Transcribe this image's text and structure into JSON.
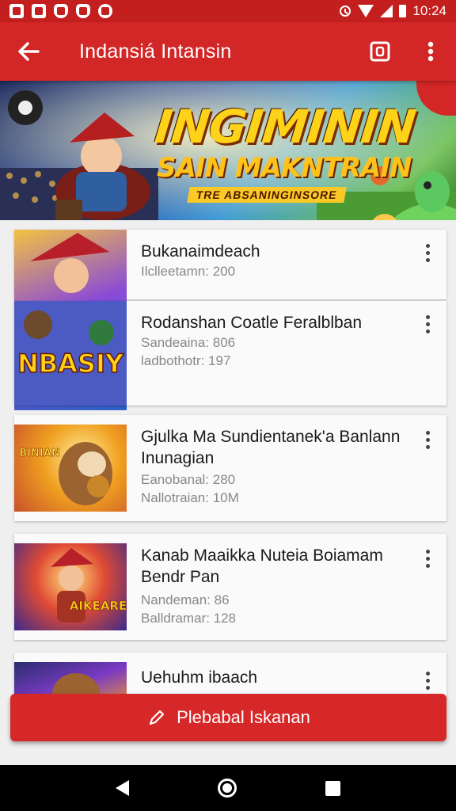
{
  "status_bar": {
    "time": "10:24"
  },
  "app_bar": {
    "title": "Indansiá Intansin"
  },
  "banner": {
    "title": "INGIMININ",
    "subtitle": "SAIN MAKNTRAIN",
    "tagline": "TRE ABSANINGINSORE"
  },
  "items": [
    {
      "title": "Bukanaimdeach",
      "meta": [
        "Ilclleetamn: 200"
      ],
      "thumb_text": ""
    },
    {
      "title": "Rodanshan Coatle Feralblban",
      "meta": [
        "Sandeaina: 806",
        "ladbothotr: 197"
      ],
      "thumb_text": "NBASIY"
    },
    {
      "title": "Gjulka Ma Sundientanek'a Banlann Inunagian",
      "meta": [
        "Eanobanal: 280",
        "Nallotraian: 10M"
      ],
      "thumb_text": "BINIAN"
    },
    {
      "title": "Kanab Maaikka Nuteia Boiamam Bendr Pan",
      "meta": [
        "Nandeman: 86",
        "Balldramar: 128"
      ],
      "thumb_text": "AIKEARE"
    },
    {
      "title": "Uehuhm ibaach",
      "meta": [],
      "thumb_text": ""
    }
  ],
  "fab": {
    "label": "Plebabal Iskanan",
    "icon": "pencil-icon"
  },
  "colors": {
    "primary": "#d32626",
    "status": "#c41f1f",
    "background": "#efefef"
  }
}
